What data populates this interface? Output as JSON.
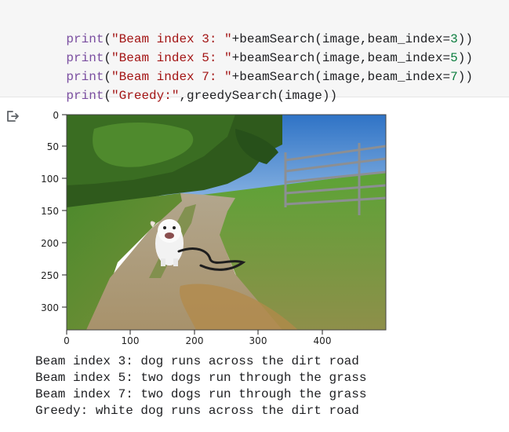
{
  "code_cell": {
    "lines": [
      {
        "fn": "print",
        "open": "(",
        "str": "\"Beam index 3: \"",
        "rest": "+beamSearch(image,beam_index=",
        "num": "3",
        "close": "))"
      },
      {
        "fn": "print",
        "open": "(",
        "str": "\"Beam index 5: \"",
        "rest": "+beamSearch(image,beam_index=",
        "num": "5",
        "close": "))"
      },
      {
        "fn": "print",
        "open": "(",
        "str": "\"Beam index 7: \"",
        "rest": "+beamSearch(image,beam_index=",
        "num": "7",
        "close": "))"
      },
      {
        "fn": "print",
        "open": "(",
        "str": "\"Greedy:\"",
        "rest": ",greedySearch(image)",
        "num": "",
        "close": ")"
      }
    ]
  },
  "output": {
    "icon": "output-arrow-icon",
    "plot": {
      "yticks": [
        "0",
        "50",
        "100",
        "150",
        "200",
        "250",
        "300"
      ],
      "xticks": [
        "0",
        "100",
        "200",
        "300",
        "400"
      ],
      "image_description_icon": "dog-on-dirt-road-photo"
    },
    "text_lines": [
      "Beam index 3: dog runs across the dirt road",
      "Beam index 5: two dogs run through the grass",
      "Beam index 7: two dogs run through the grass",
      "Greedy: white dog runs across the dirt road"
    ]
  }
}
